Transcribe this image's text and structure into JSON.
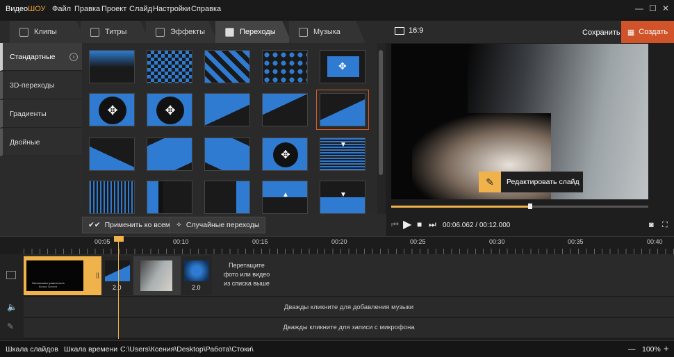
{
  "app": {
    "logo_part1": "Видео",
    "logo_part2": "ШОУ"
  },
  "menu": [
    "Файл",
    "Правка",
    "Проект",
    "Слайд",
    "Настройки",
    "Справка"
  ],
  "window_controls": {
    "minimize": "—",
    "maximize": "☐",
    "close": "✕"
  },
  "tabs": [
    {
      "label": "Клипы",
      "icon": "play-icon"
    },
    {
      "label": "Титры",
      "icon": "text-icon"
    },
    {
      "label": "Эффекты",
      "icon": "magic-wand-icon"
    },
    {
      "label": "Переходы",
      "icon": "transitions-icon",
      "active": true
    },
    {
      "label": "Музыка",
      "icon": "music-icon"
    }
  ],
  "sidebar": {
    "items": [
      {
        "label": "Стандартные",
        "active": true
      },
      {
        "label": "3D-переходы"
      },
      {
        "label": "Градиенты"
      },
      {
        "label": "Двойные"
      }
    ]
  },
  "buttons": {
    "apply_all": "Применить ко всем",
    "random": "Случайные переходы"
  },
  "preview": {
    "aspect": "16:9",
    "save": "Сохранить",
    "create": "Создать",
    "edit_slide": "Редактировать слайд",
    "timecode_current": "00:06.062",
    "timecode_separator": " / ",
    "timecode_total": "00:12.000",
    "progress": 0.54
  },
  "ruler": {
    "labels": [
      "00:05",
      "00:10",
      "00:15",
      "00:20",
      "00:25",
      "00:30",
      "00:35",
      "00:40"
    ]
  },
  "timeline": {
    "slide1_text1": "Финансовая грамотность",
    "slide1_text2": "Выпуск Проекта",
    "transition_duration_1": "2.0",
    "transition_duration_2": "2.0",
    "drop_hint": "Перетащите\nфото или видео\nиз списка выше",
    "music_hint": "Дважды кликните для добавления музыки",
    "mic_hint": "Дважды кликните для записи с микрофона"
  },
  "statusbar": {
    "slides_scale": "Шкала слайдов",
    "time_scale": "Шкала времени",
    "path": "C:\\Users\\Ксения\\Desktop\\Работа\\Стоки\\",
    "zoom_minus": "—",
    "zoom": "100%",
    "zoom_plus": "+"
  },
  "colors": {
    "accent": "#f0b24a",
    "create": "#d0532a",
    "thumb_blue": "#2e7bd1"
  }
}
